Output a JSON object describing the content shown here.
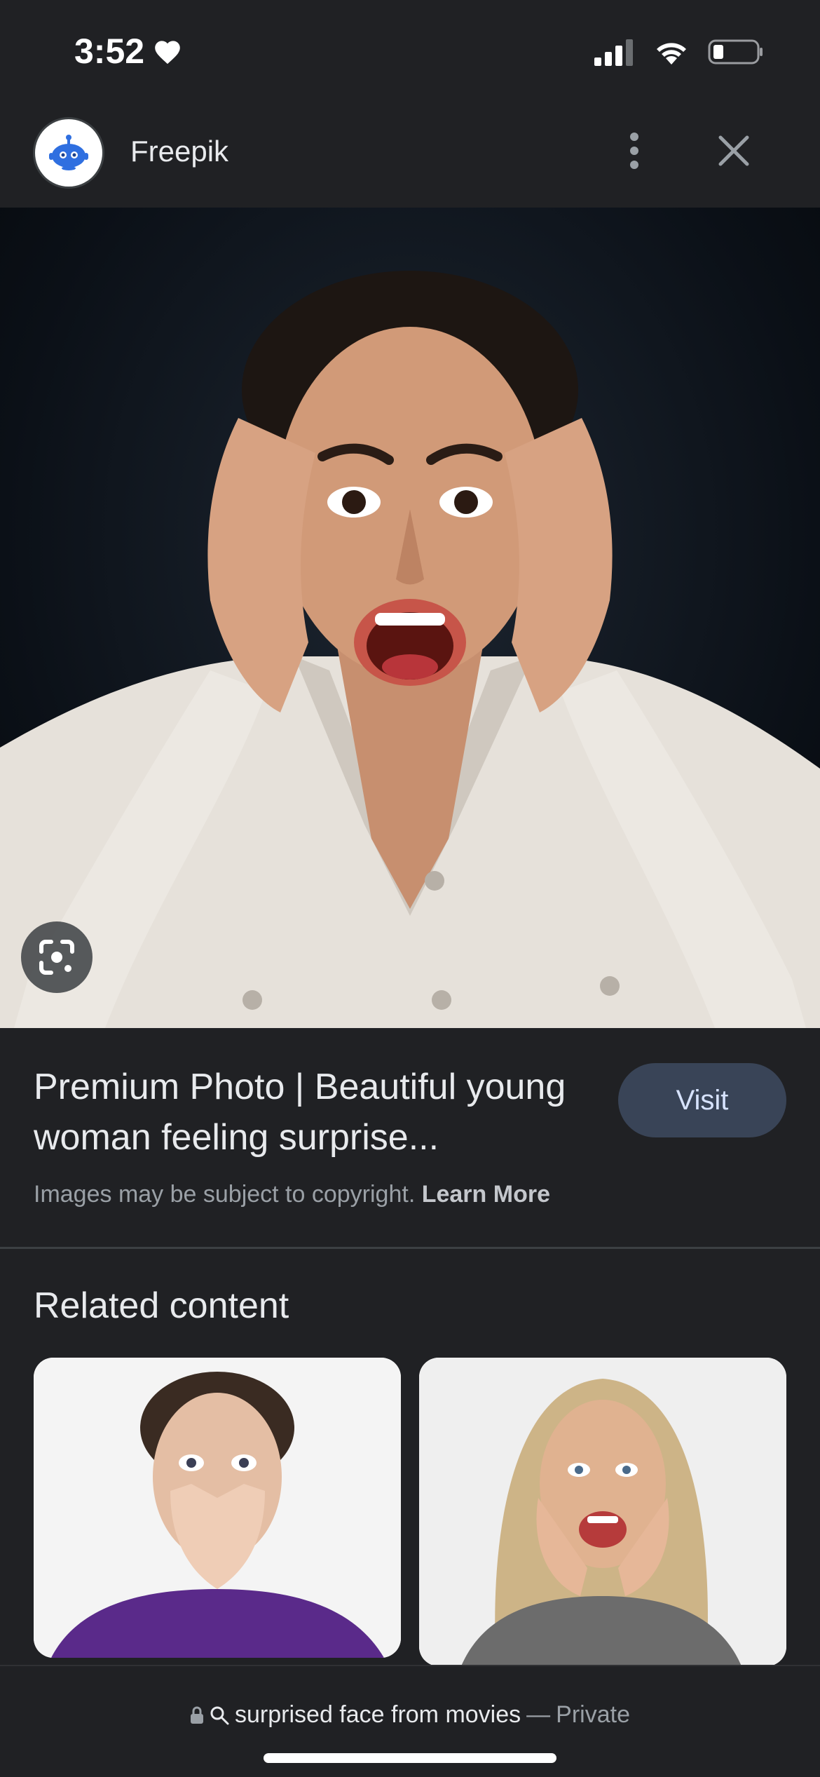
{
  "status_bar": {
    "time": "3:52"
  },
  "header": {
    "site_name": "Freepik"
  },
  "result": {
    "title": "Premium Photo | Beautiful young woman feeling surprise...",
    "visit_label": "Visit",
    "copyright_text": "Images may be subject to copyright.",
    "learn_more": "Learn More"
  },
  "related": {
    "heading": "Related content"
  },
  "bottom_bar": {
    "query": "surprised face from movies",
    "separator": "—",
    "mode": "Private"
  },
  "colors": {
    "background": "#202124",
    "visit_button": "#394457",
    "visit_text": "#d7e3ff",
    "secondary_text": "#9aa0a6"
  },
  "icons": {
    "status": [
      "heart-icon",
      "signal-icon",
      "wifi-icon",
      "battery-icon"
    ],
    "header": [
      "freepik-logo-icon",
      "more-vert-icon",
      "close-icon"
    ],
    "image": [
      "google-lens-icon"
    ],
    "bottom": [
      "lock-icon",
      "search-icon"
    ]
  }
}
